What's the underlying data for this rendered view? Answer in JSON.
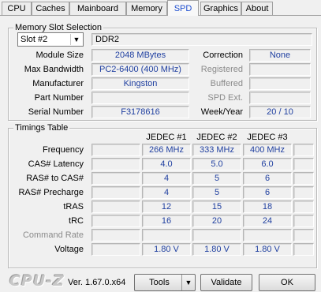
{
  "tabs": [
    "CPU",
    "Caches",
    "Mainboard",
    "Memory",
    "SPD",
    "Graphics",
    "About"
  ],
  "active_tab": "SPD",
  "slot_group": {
    "title": "Memory Slot Selection",
    "slot": "Slot #2",
    "type": "DDR2",
    "module_size_label": "Module Size",
    "module_size": "2048 MBytes",
    "max_bandwidth_label": "Max Bandwidth",
    "max_bandwidth": "PC2-6400 (400 MHz)",
    "manufacturer_label": "Manufacturer",
    "manufacturer": "Kingston",
    "part_number_label": "Part Number",
    "part_number": "",
    "serial_number_label": "Serial Number",
    "serial_number": "F3178616",
    "correction_label": "Correction",
    "correction": "None",
    "registered_label": "Registered",
    "registered": "",
    "buffered_label": "Buffered",
    "buffered": "",
    "spd_ext_label": "SPD Ext.",
    "spd_ext": "",
    "week_year_label": "Week/Year",
    "week_year": "20 / 10"
  },
  "timings": {
    "title": "Timings Table",
    "columns": [
      "JEDEC #1",
      "JEDEC #2",
      "JEDEC #3"
    ],
    "rows": [
      {
        "label": "Frequency",
        "values": [
          "266 MHz",
          "333 MHz",
          "400 MHz"
        ]
      },
      {
        "label": "CAS# Latency",
        "values": [
          "4.0",
          "5.0",
          "6.0"
        ]
      },
      {
        "label": "RAS# to CAS#",
        "values": [
          "4",
          "5",
          "6"
        ]
      },
      {
        "label": "RAS# Precharge",
        "values": [
          "4",
          "5",
          "6"
        ]
      },
      {
        "label": "tRAS",
        "values": [
          "12",
          "15",
          "18"
        ]
      },
      {
        "label": "tRC",
        "values": [
          "16",
          "20",
          "24"
        ]
      },
      {
        "label": "Command Rate",
        "values": [
          "",
          "",
          ""
        ]
      },
      {
        "label": "Voltage",
        "values": [
          "1.80 V",
          "1.80 V",
          "1.80 V"
        ]
      }
    ]
  },
  "footer": {
    "logo": "CPU-Z",
    "version": "Ver. 1.67.0.x64",
    "tools": "Tools",
    "validate": "Validate",
    "ok": "OK"
  }
}
